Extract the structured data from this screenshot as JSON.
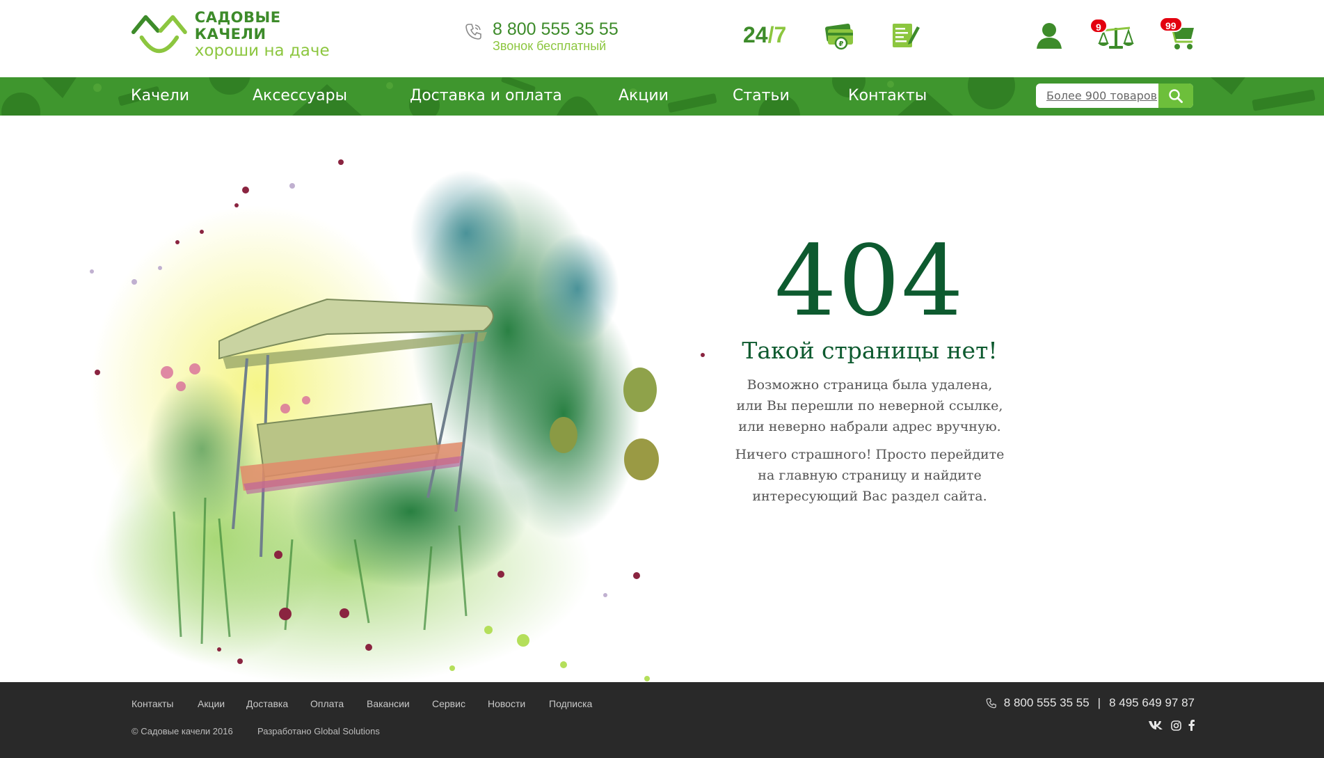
{
  "logo": {
    "title": "САДОВЫЕ КАЧЕЛИ",
    "subtitle": "хороши на даче"
  },
  "header": {
    "phone": "8 800 555 35 55",
    "phone_note": "Звонок бесплатный",
    "hours_left": "24",
    "hours_slash": "/",
    "hours_right": "7",
    "compare_count": "9",
    "cart_count": "99"
  },
  "nav": {
    "items": [
      "Качели",
      "Аксессуары",
      "Доставка и оплата",
      "Акции",
      "Статьи",
      "Контакты"
    ]
  },
  "search": {
    "placeholder": "Более 900 товаров"
  },
  "error": {
    "code": "404",
    "title": "Такой страницы нет!",
    "p1_l1": "Возможно страница была удалена,",
    "p1_l2": "или Вы перешли по неверной ссылке,",
    "p1_l3": "или неверно набрали адрес вручную.",
    "p2_l1": "Ничего страшного! Просто перейдите",
    "p2_l2": "на главную страницу и найдите",
    "p2_l3": "интересующий Вас раздел сайта."
  },
  "footer": {
    "links": [
      "Контакты",
      "Акции",
      "Доставка",
      "Оплата",
      "Вакансии",
      "Сервис",
      "Новости",
      "Подписка"
    ],
    "copyright": "©  Садовые качели 2016",
    "developer": "Разработано Global Solutions",
    "phone1": "8 800 555 35 55",
    "separator": "|",
    "phone2": "8 495 649 97 87"
  },
  "colors": {
    "brand_dark": "#3d8b2a",
    "brand_light": "#8cc63f",
    "nav_bg": "#3f962e",
    "heading": "#0d5a2f",
    "badge": "#e3000f",
    "footer_bg": "#292929"
  },
  "icons": [
    "phone-icon",
    "payment-icon",
    "order-form-icon",
    "user-icon",
    "compare-scales-icon",
    "cart-icon",
    "search-icon",
    "vk-icon",
    "instagram-icon",
    "facebook-icon"
  ]
}
